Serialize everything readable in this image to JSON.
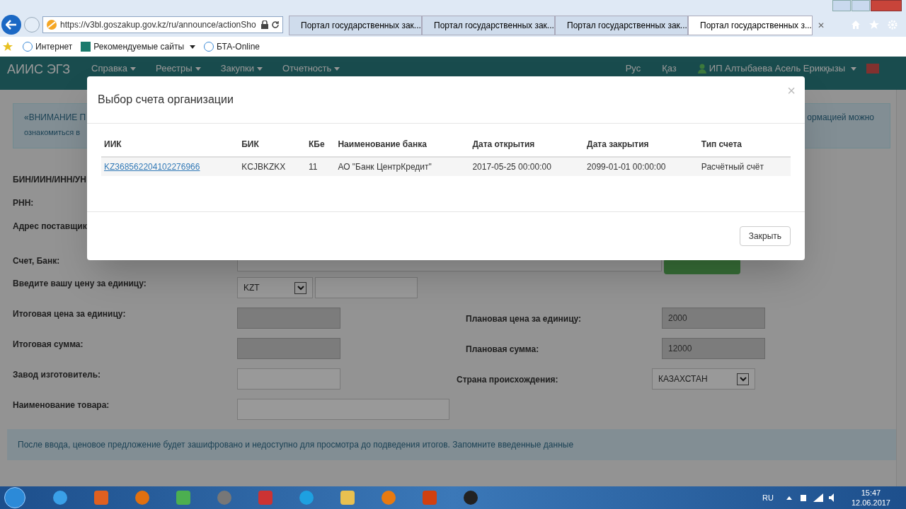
{
  "browser": {
    "address": "https://v3bl.goszakup.gov.kz/ru/announce/actionSho",
    "tabs": [
      {
        "title": "Портал государственных зак...",
        "selected": false
      },
      {
        "title": "Портал государственных зак...",
        "selected": false
      },
      {
        "title": "Портал государственных зак...",
        "selected": false
      },
      {
        "title": "Портал государственных з...",
        "selected": true
      }
    ],
    "tab_close": "✕",
    "favorites": [
      "Интернет",
      "Рекомендуемые сайты",
      "БТА-Online"
    ]
  },
  "site": {
    "brand": "АИИС ЭГЗ",
    "menu": [
      "Справка",
      "Реестры",
      "Закупки",
      "Отчетность"
    ],
    "langs": [
      "Рус",
      "Қаз"
    ],
    "user": "ИП Алтыбаева Асель Ерикқызы"
  },
  "page": {
    "notice_left": [
      "«ВНИМАНИЕ П",
      "ознакомиться в"
    ],
    "notice_right": "ормацией можно",
    "covered_labels": [
      "БИН/ИИН/ИНН/УН",
      "РНН:",
      "Адрес поставщик",
      "Счет, Банк:"
    ],
    "rows": [
      {
        "label": "Введите вашу цену за единицу:",
        "fields": [
          {
            "kind": "select",
            "value": "KZT"
          },
          {
            "kind": "input",
            "disabled": false
          }
        ]
      },
      {
        "label": "Итоговая цена за единицу:",
        "fields": [
          {
            "kind": "input",
            "disabled": true
          }
        ],
        "right": {
          "label": "Плановая цена за единицу:",
          "field": {
            "kind": "input",
            "disabled": true,
            "value": "2000"
          }
        }
      },
      {
        "label": "Итоговая сумма:",
        "fields": [
          {
            "kind": "input",
            "disabled": true
          }
        ],
        "right": {
          "label": "Плановая сумма:",
          "field": {
            "kind": "input",
            "disabled": true,
            "value": "12000"
          }
        }
      },
      {
        "label": "Завод изготовитель:",
        "fields": [
          {
            "kind": "input",
            "disabled": false
          }
        ],
        "right": {
          "label": "Страна происхождения:",
          "field": {
            "kind": "select",
            "value": "КАЗАХСТАН"
          }
        }
      },
      {
        "label": "Наименование товара:",
        "fields": [
          {
            "kind": "wide",
            "disabled": false
          }
        ]
      }
    ],
    "footer_notice": "После ввода, ценовое предложение будет зашифровано и недоступно для просмотра до подведения итогов. Запомните введенные данные"
  },
  "modal": {
    "title": "Выбор счета организации",
    "close": "×",
    "columns": [
      "ИИК",
      "БИК",
      "КБе",
      "Наименование банка",
      "Дата открытия",
      "Дата закрытия",
      "Тип счета"
    ],
    "rows": [
      {
        "cells": [
          "KZ368562204102276966",
          "KCJBKZKX",
          "11",
          "АО \"Банк ЦентрКредит\"",
          "2017-05-25 00:00:00",
          "2099-01-01 00:00:00",
          "Расчётный счёт"
        ]
      }
    ],
    "button": "Закрыть"
  },
  "taskbar": {
    "lang": "RU",
    "time": "15:47",
    "date": "12.06.2017"
  }
}
